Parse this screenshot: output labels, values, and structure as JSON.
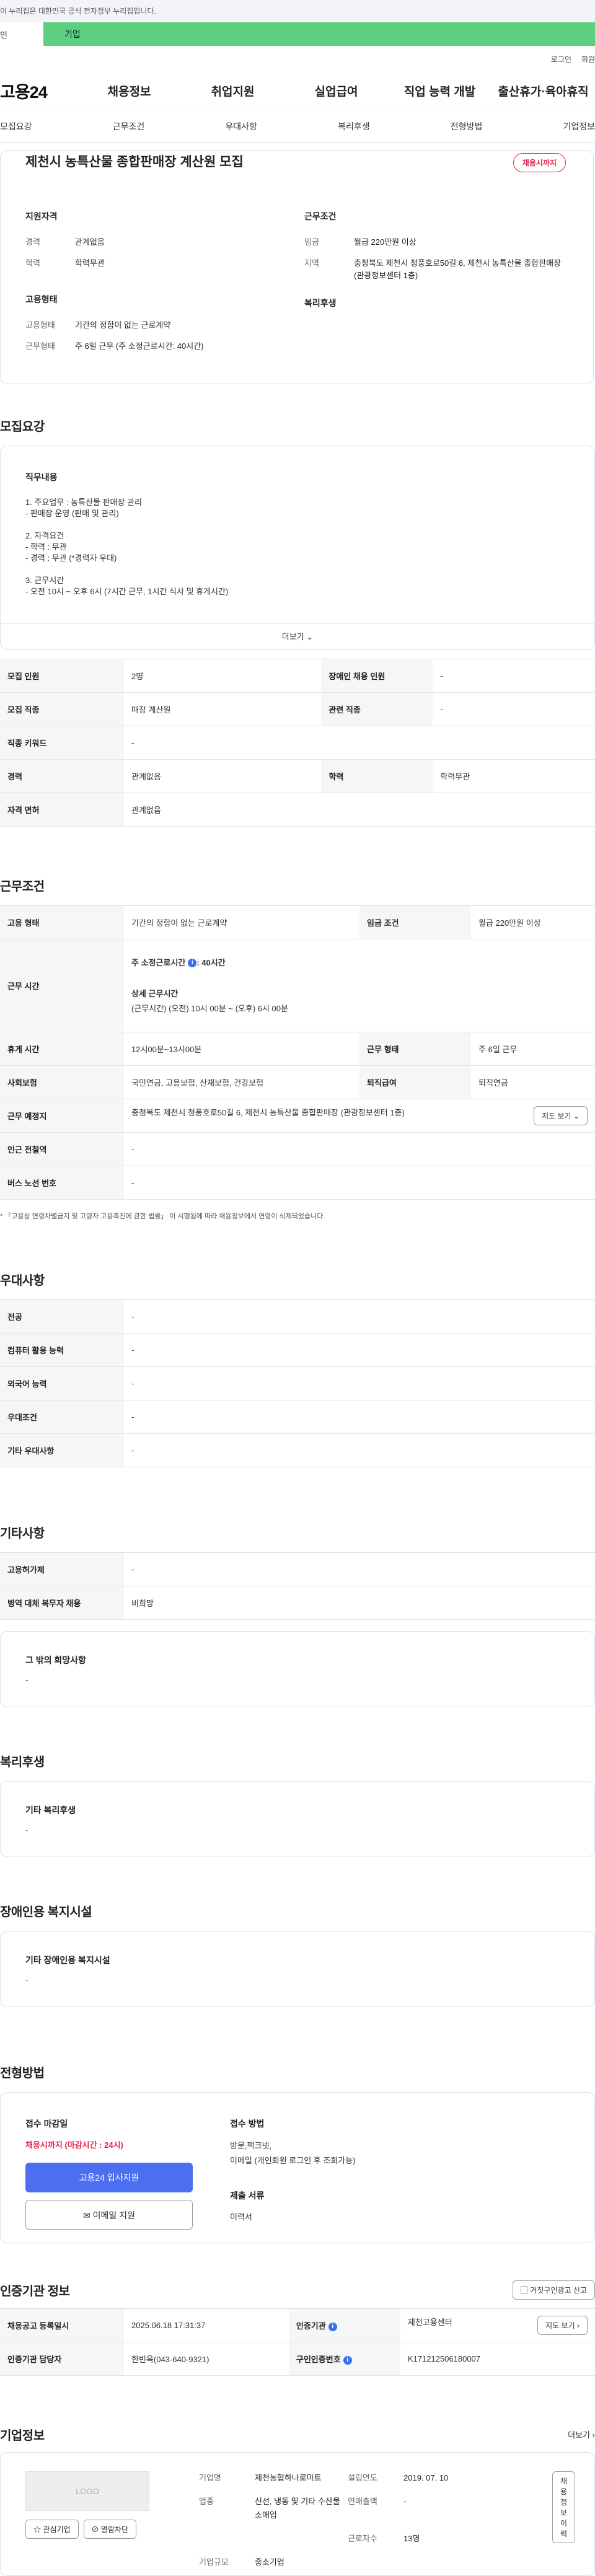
{
  "gov_banner": "이 누리집은 대한민국 공식 전자정부 누리집입니다.",
  "tagbar": {
    "label": "인",
    "value": "기업"
  },
  "util": [
    "로그인",
    "회원"
  ],
  "gnb": {
    "logo": "고용24",
    "items": [
      "채용정보",
      "취업지원",
      "실업급여",
      "직업 능력 개발",
      "출산휴가·육아휴직"
    ]
  },
  "tabs": [
    "모집요강",
    "근무조건",
    "우대사항",
    "복리후생",
    "전형방법",
    "기업정보"
  ],
  "header": {
    "title": "제천시 농특산물 종합판매장 계산원 모집",
    "badge": "채용시까지",
    "qual_title": "지원자격",
    "cond_title": "근무조건",
    "emp_title": "고용형태",
    "welfare_title": "복리후생",
    "qual": [
      {
        "k": "경력",
        "v": "관계없음"
      },
      {
        "k": "학력",
        "v": "학력무관"
      }
    ],
    "cond": [
      {
        "k": "임금",
        "v": "월급 220만원 이상"
      },
      {
        "k": "지역",
        "v": "충청북도 제천시 청풍호로50길 6, 제천시 농특산물 종합판매장 (관광정보센터 1층)"
      }
    ],
    "emp": [
      {
        "k": "고용형태",
        "v": "기간의 정함이 없는 근로계약"
      },
      {
        "k": "근무형태",
        "v": "주 6일 근무 (주 소정근로시간: 40시간)"
      }
    ]
  },
  "recruit": {
    "section": "모집요강",
    "jd_title": "직무내용",
    "jd_text": "1. 주요업무 : 농특산물 판매장 관리\n- 판매장 운영 (판매 및 관리)\n\n2. 자격요건\n- 학력 : 무관\n- 경력 : 무관 (*경력자 우대)\n\n3. 근무시간\n- 오전 10시 ~ 오후 6시 (7시간 근무, 1시간 식사 및 휴게시간)",
    "more": "더보기",
    "r1": {
      "k1": "모집 인원",
      "v1": "2명",
      "k2": "장애인 채용 인원",
      "v2": "-"
    },
    "r2": {
      "k1": "모집 직종",
      "v1": "매장 계산원",
      "k2": "관련 직종",
      "v2": "-"
    },
    "r3": {
      "k": "직종 키워드",
      "v": "-"
    },
    "r4": {
      "k1": "경력",
      "v1": "관계없음",
      "k2": "학력",
      "v2": "학력무관"
    },
    "r5": {
      "k": "자격 면허",
      "v": "관계없음"
    }
  },
  "work": {
    "section": "근무조건",
    "r1": {
      "k1": "고용 형태",
      "v1": "기간의 정함이 없는 근로계약",
      "k2": "임금 조건",
      "v2": "월급 220만원 이상"
    },
    "time": {
      "k": "근무 시간",
      "l1": "주 소정근로시간",
      "l1v": ": 40시간",
      "l2": "상세 근무시간",
      "l3": "(근무시간) (오전) 10시 00분 ~ (오후) 6시 00분"
    },
    "r3": {
      "k1": "휴게 시간",
      "v1": "12시00분~13시00분",
      "k2": "근무 형태",
      "v2": "주 6일 근무"
    },
    "r4": {
      "k1": "사회보험",
      "v1": "국민연금, 고용보험, 산재보험, 건강보험",
      "k2": "퇴직급여",
      "v2": "퇴직연금"
    },
    "r5": {
      "k": "근무 예정지",
      "v": "충청북도 제천시 청풍호로50길 6, 제천시 농특산물 종합판매장 (관광정보센터 1층)",
      "btn": "지도 보기"
    },
    "r6": {
      "k": "인근 전철역",
      "v": "-"
    },
    "r7": {
      "k": "버스 노선 번호",
      "v": "-"
    },
    "note": "* 「고용상 연령차별금지 및 고령자 고용촉진에 관한 법률」 이 시행됨에 따라 채용정보에서 연령이 삭제되었습니다."
  },
  "pref": {
    "section": "우대사항",
    "rows": [
      {
        "k": "전공",
        "v": "-"
      },
      {
        "k": "컴퓨터 활용 능력",
        "v": "-"
      },
      {
        "k": "외국어 능력",
        "v": "-"
      },
      {
        "k": "우대조건",
        "v": "-"
      },
      {
        "k": "기타 우대사항",
        "v": "-"
      }
    ]
  },
  "etc": {
    "section": "기타사항",
    "rows": [
      {
        "k": "고용허가제",
        "v": "-"
      },
      {
        "k": "병역 대체 복무자 채용",
        "v": "비희망"
      }
    ],
    "box_title": "그 밖의 희망사항",
    "box_value": "-"
  },
  "welfare": {
    "section": "복리후생",
    "box_title": "기타 복리후생",
    "box_value": "-"
  },
  "disabled": {
    "section": "장애인용 복지시설",
    "box_title": "기타 장애인용 복지시설",
    "box_value": "-"
  },
  "process": {
    "section": "전형방법",
    "deadline_title": "접수 마감일",
    "deadline": "채용시까지 (마감시간 : 24시)",
    "apply_btn": "고용24 입사지원",
    "email_btn": "이메일 지원",
    "method_title": "접수 방법",
    "method": "방문,팩크넷,\n이메일 (개인회원 로그인 후 조회가능)",
    "docs_title": "제출 서류",
    "docs": "이력서"
  },
  "cert": {
    "section": "인증기관 정보",
    "report_btn": "거짓구인광고 신고",
    "r1": {
      "k1": "채용공고 등록일시",
      "v1": "2025.06.18 17:31:37",
      "k2": "인증기관",
      "v2": "제천고용센터",
      "btn": "지도 보기"
    },
    "r2": {
      "k1": "인증기관 담당자",
      "v1": "한빈옥(043-640-9321)",
      "k2": "구인인증번호",
      "v2": "K171212506180007"
    }
  },
  "company": {
    "section": "기업정보",
    "more": "더보기",
    "logo": "LOGO",
    "fav": "관심기업",
    "block": "열람차단",
    "k1": "기업명",
    "v1": "제천농협하나로마트",
    "k2": "설립연도",
    "v2": "2019. 07. 10",
    "btn": "채용정보 이력",
    "k3": "업종",
    "v3": "신선, 냉동 및 기타 수산물 소매업",
    "k4": "연매출액",
    "v4": "-",
    "k5": "근로자수",
    "v5": "13명",
    "k6": "기업규모",
    "v6": "중소기업"
  }
}
